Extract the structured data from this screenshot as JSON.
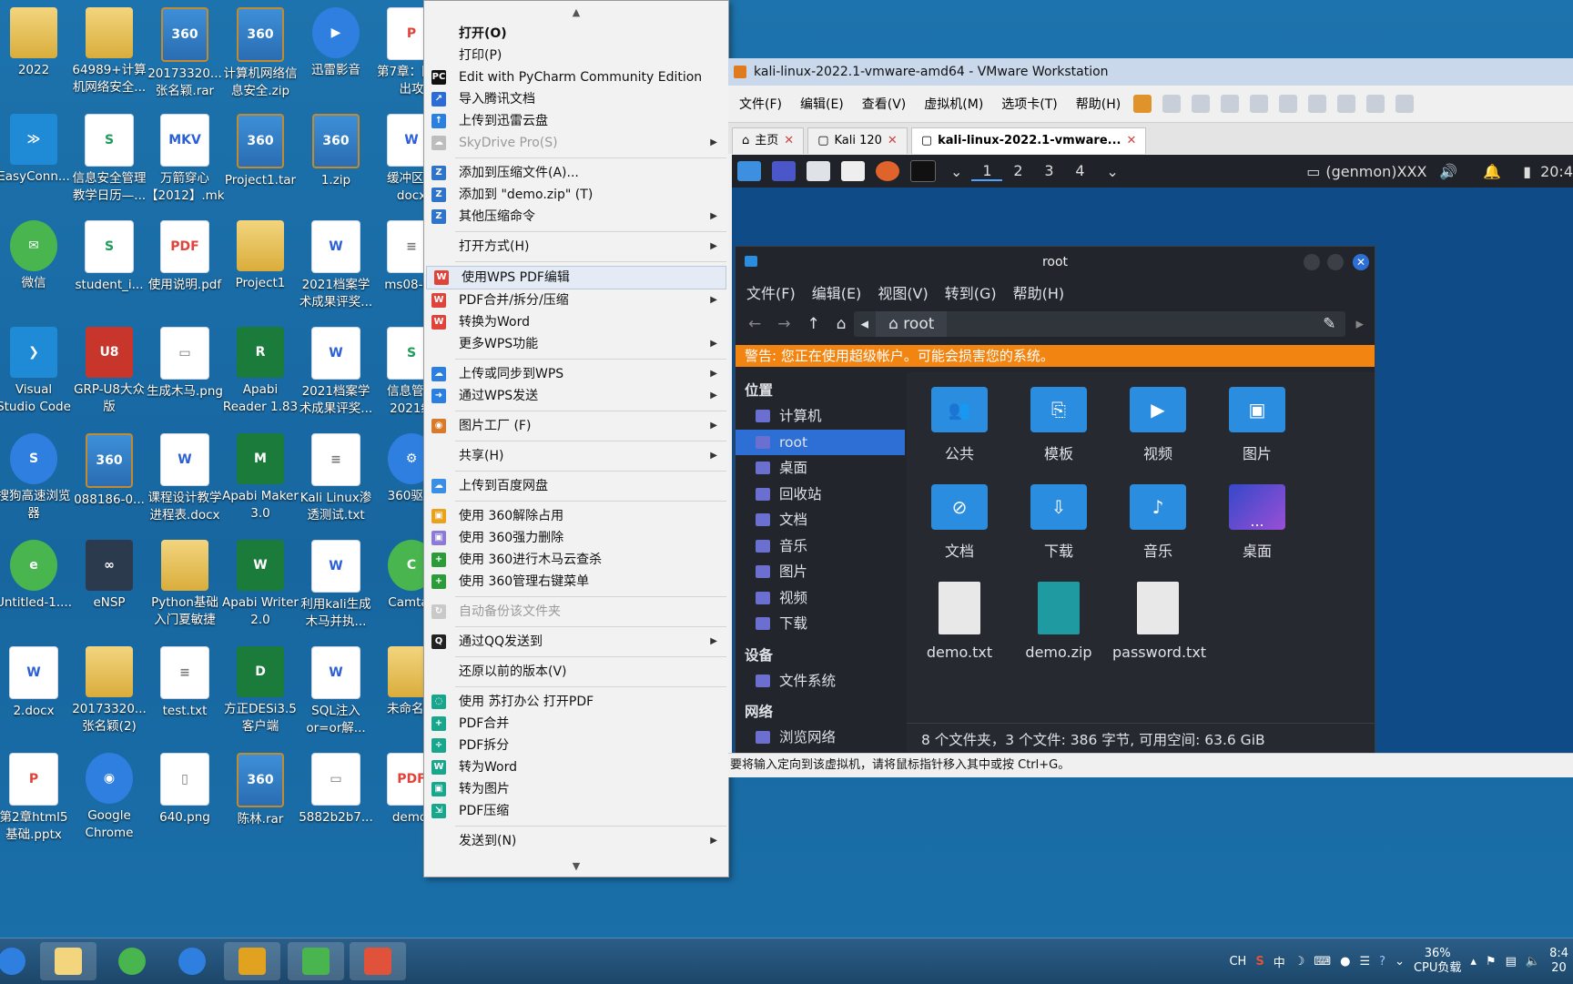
{
  "desktop": {
    "icons": [
      {
        "label": "2022",
        "kind": "folder",
        "glyph": ""
      },
      {
        "label": "64989+计算机网络安全...",
        "kind": "folder",
        "glyph": ""
      },
      {
        "label": "20173320...张名颖.rar",
        "kind": "zip",
        "glyph": "360"
      },
      {
        "label": "计算机网络信息安全.zip",
        "kind": "zip",
        "glyph": "360"
      },
      {
        "label": "迅雷影音",
        "kind": "blue",
        "glyph": "▶"
      },
      {
        "label": "第7章：区溢出攻",
        "kind": "pdf",
        "glyph": "P"
      },
      {
        "label": "EasyConn...",
        "kind": "vs",
        "glyph": "≫"
      },
      {
        "label": "信息安全管理教学日历—...",
        "kind": "xls",
        "glyph": "S"
      },
      {
        "label": "万箭穿心【2012】.mkv",
        "kind": "doc",
        "glyph": "MKV"
      },
      {
        "label": "Project1.tar",
        "kind": "zip",
        "glyph": "360"
      },
      {
        "label": "1.zip",
        "kind": "zip",
        "glyph": "360"
      },
      {
        "label": "缓冲区溢docx",
        "kind": "doc",
        "glyph": "W"
      },
      {
        "label": "微信",
        "kind": "green",
        "glyph": "✉"
      },
      {
        "label": "student_i...",
        "kind": "xls",
        "glyph": "S"
      },
      {
        "label": "使用说明.pdf",
        "kind": "pdf",
        "glyph": "PDF"
      },
      {
        "label": "Project1",
        "kind": "folder",
        "glyph": ""
      },
      {
        "label": "2021档案学术成果评奖...",
        "kind": "doc",
        "glyph": "W"
      },
      {
        "label": "ms08-06",
        "kind": "txt",
        "glyph": "≡"
      },
      {
        "label": "Visual Studio Code",
        "kind": "vs",
        "glyph": "❯"
      },
      {
        "label": "GRP-U8大众版",
        "kind": "red",
        "glyph": "U8"
      },
      {
        "label": "生成木马.png",
        "kind": "txt",
        "glyph": "▭"
      },
      {
        "label": "Apabi Reader 1.83",
        "kind": "app",
        "glyph": "R"
      },
      {
        "label": "2021档案学术成果评奖...",
        "kind": "doc",
        "glyph": "W"
      },
      {
        "label": "信息管理2021级",
        "kind": "xls",
        "glyph": "S"
      },
      {
        "label": "搜狗高速浏览器",
        "kind": "blue",
        "glyph": "S"
      },
      {
        "label": "088186-0...",
        "kind": "zip",
        "glyph": "360"
      },
      {
        "label": "课程设计教学进程表.docx",
        "kind": "doc",
        "glyph": "W"
      },
      {
        "label": "Apabi Maker 3.0",
        "kind": "app",
        "glyph": "M"
      },
      {
        "label": "Kali Linux渗透测试.txt",
        "kind": "txt",
        "glyph": "≡"
      },
      {
        "label": "360驱动",
        "kind": "blue",
        "glyph": "⚙"
      },
      {
        "label": "Untitled-1....",
        "kind": "green",
        "glyph": "e"
      },
      {
        "label": "eNSP",
        "kind": "dark",
        "glyph": "∞"
      },
      {
        "label": "Python基础入门夏敏捷",
        "kind": "folder",
        "glyph": ""
      },
      {
        "label": "Apabi Writer 2.0",
        "kind": "app",
        "glyph": "W"
      },
      {
        "label": "利用kali生成木马并执...",
        "kind": "doc",
        "glyph": "W"
      },
      {
        "label": "Camtas",
        "kind": "green",
        "glyph": "C"
      },
      {
        "label": "2.docx",
        "kind": "doc",
        "glyph": "W"
      },
      {
        "label": "20173320...张名颖(2)",
        "kind": "folder",
        "glyph": ""
      },
      {
        "label": "test.txt",
        "kind": "txt",
        "glyph": "≡"
      },
      {
        "label": "方正DESi3.5客户端",
        "kind": "app",
        "glyph": "D"
      },
      {
        "label": "SQL注入or=or解...",
        "kind": "doc",
        "glyph": "W"
      },
      {
        "label": "未命名项",
        "kind": "folder",
        "glyph": ""
      },
      {
        "label": "第2章html5基础.pptx",
        "kind": "pdf",
        "glyph": "P"
      },
      {
        "label": "Google Chrome",
        "kind": "blue",
        "glyph": "◉"
      },
      {
        "label": "640.png",
        "kind": "txt",
        "glyph": "▯"
      },
      {
        "label": "陈林.rar",
        "kind": "zip",
        "glyph": "360"
      },
      {
        "label": "5882b2b7...",
        "kind": "txt",
        "glyph": "▭"
      },
      {
        "label": "demo.",
        "kind": "pdf",
        "glyph": "PDF"
      }
    ]
  },
  "context_menu": {
    "items": [
      {
        "label": "打开(O)",
        "bold": true,
        "icon": "",
        "color": "",
        "arrow": false,
        "disabled": false
      },
      {
        "label": "打印(P)",
        "icon": "",
        "color": "",
        "arrow": false
      },
      {
        "label": "Edit with PyCharm Community Edition",
        "icon": "PC",
        "color": "#111111",
        "arrow": false
      },
      {
        "label": "导入腾讯文档",
        "icon": "↗",
        "color": "#2b6cd6",
        "arrow": false
      },
      {
        "label": "上传到迅雷云盘",
        "icon": "↑",
        "color": "#2b7fe0",
        "arrow": false
      },
      {
        "label": "SkyDrive Pro(S)",
        "icon": "☁",
        "color": "#bdbdbd",
        "arrow": true,
        "disabled": true
      },
      {
        "sep": true
      },
      {
        "label": "添加到压缩文件(A)...",
        "icon": "Z",
        "color": "#2f74c9",
        "arrow": false
      },
      {
        "label": "添加到 \"demo.zip\" (T)",
        "icon": "Z",
        "color": "#2f74c9",
        "arrow": false
      },
      {
        "label": "其他压缩命令",
        "icon": "Z",
        "color": "#2f74c9",
        "arrow": true
      },
      {
        "sep": true
      },
      {
        "label": "打开方式(H)",
        "icon": "",
        "color": "",
        "arrow": true
      },
      {
        "sep": true
      },
      {
        "label": "使用WPS PDF编辑",
        "icon": "W",
        "color": "#e0433a",
        "arrow": false,
        "highlight": true
      },
      {
        "label": "PDF合并/拆分/压缩",
        "icon": "W",
        "color": "#e0433a",
        "arrow": true
      },
      {
        "label": "转换为Word",
        "icon": "W",
        "color": "#e0433a",
        "arrow": false
      },
      {
        "label": "更多WPS功能",
        "icon": "",
        "color": "",
        "arrow": true
      },
      {
        "sep": true
      },
      {
        "label": "上传或同步到WPS",
        "icon": "☁",
        "color": "#2b7fe0",
        "arrow": true
      },
      {
        "label": "通过WPS发送",
        "icon": "➜",
        "color": "#2b7fe0",
        "arrow": true
      },
      {
        "sep": true
      },
      {
        "label": "图片工厂 (F)",
        "icon": "◉",
        "color": "#d77a2b",
        "arrow": true
      },
      {
        "sep": true
      },
      {
        "label": "共享(H)",
        "icon": "",
        "color": "",
        "arrow": true
      },
      {
        "sep": true
      },
      {
        "label": "上传到百度网盘",
        "icon": "☁",
        "color": "#3a8ee6",
        "arrow": false
      },
      {
        "sep": true
      },
      {
        "label": "使用 360解除占用",
        "icon": "▣",
        "color": "#e9a21c",
        "arrow": false
      },
      {
        "label": "使用 360强力删除",
        "icon": "▣",
        "color": "#8d7ad6",
        "arrow": false
      },
      {
        "label": "使用 360进行木马云查杀",
        "icon": "+",
        "color": "#2c9c3a",
        "arrow": false
      },
      {
        "label": "使用 360管理右键菜单",
        "icon": "+",
        "color": "#2c9c3a",
        "arrow": false
      },
      {
        "sep": true
      },
      {
        "label": "自动备份该文件夹",
        "icon": "↻",
        "color": "#c9c9c9",
        "arrow": false,
        "disabled": true
      },
      {
        "sep": true
      },
      {
        "label": "通过QQ发送到",
        "icon": "Q",
        "color": "#222222",
        "arrow": true
      },
      {
        "sep": true
      },
      {
        "label": "还原以前的版本(V)",
        "icon": "",
        "color": "",
        "arrow": false
      },
      {
        "sep": true
      },
      {
        "label": "使用 苏打办公 打开PDF",
        "icon": "◌",
        "color": "#18a78c",
        "arrow": false
      },
      {
        "label": "PDF合并",
        "icon": "+",
        "color": "#18a78c",
        "arrow": false
      },
      {
        "label": "PDF拆分",
        "icon": "÷",
        "color": "#18a78c",
        "arrow": false
      },
      {
        "label": "转为Word",
        "icon": "W",
        "color": "#18a78c",
        "arrow": false
      },
      {
        "label": "转为图片",
        "icon": "▣",
        "color": "#18a78c",
        "arrow": false
      },
      {
        "label": "PDF压缩",
        "icon": "⇲",
        "color": "#18a78c",
        "arrow": false
      },
      {
        "sep": true
      },
      {
        "label": "发送到(N)",
        "icon": "",
        "color": "",
        "arrow": true
      }
    ]
  },
  "vmware": {
    "title": "kali-linux-2022.1-vmware-amd64 - VMware Workstation",
    "menus": [
      "文件(F)",
      "编辑(E)",
      "查看(V)",
      "虚拟机(M)",
      "选项卡(T)",
      "帮助(H)"
    ],
    "tabs": [
      {
        "label": "主页",
        "icon": "⌂",
        "active": false
      },
      {
        "label": "Kali 120",
        "icon": "▢",
        "active": false
      },
      {
        "label": "kali-linux-2022.1-vmware...",
        "icon": "▢",
        "active": true
      }
    ],
    "status": "要将输入定向到该虚拟机，请将鼠标指针移入其中或按 Ctrl+G。"
  },
  "kali": {
    "workspaces": [
      "1",
      "2",
      "3",
      "4"
    ],
    "genmon": "(genmon)XXX",
    "clock": "20:4",
    "fm": {
      "title": "root",
      "menus": [
        "文件(F)",
        "编辑(E)",
        "视图(V)",
        "转到(G)",
        "帮助(H)"
      ],
      "path": "root",
      "warning": "警告: 您正在使用超级帐户。可能会损害您的系统。",
      "sidebar": {
        "places_header": "位置",
        "places": [
          "计算机",
          "root",
          "桌面",
          "回收站",
          "文档",
          "音乐",
          "图片",
          "视频",
          "下载"
        ],
        "devices_header": "设备",
        "devices": [
          "文件系统"
        ],
        "network_header": "网络",
        "network": [
          "浏览网络"
        ]
      },
      "items": [
        {
          "label": "公共",
          "type": "folder",
          "glyph": "👥"
        },
        {
          "label": "模板",
          "type": "folder",
          "glyph": "⎘"
        },
        {
          "label": "视频",
          "type": "folder",
          "glyph": "▶"
        },
        {
          "label": "图片",
          "type": "folder",
          "glyph": "▣"
        },
        {
          "label": "文档",
          "type": "folder",
          "glyph": "⊘"
        },
        {
          "label": "下载",
          "type": "folder",
          "glyph": "⇩"
        },
        {
          "label": "音乐",
          "type": "folder",
          "glyph": "♪"
        },
        {
          "label": "桌面",
          "type": "desk",
          "glyph": "..."
        },
        {
          "label": "demo.txt",
          "type": "file",
          "glyph": ""
        },
        {
          "label": "demo.zip",
          "type": "zipf",
          "glyph": ""
        },
        {
          "label": "password.txt",
          "type": "file",
          "glyph": ""
        }
      ],
      "status": "8 个文件夹，3 个文件: 386 字节, 可用空间: 63.6 GiB"
    }
  },
  "taskbar": {
    "tray": {
      "ime": "CH",
      "lang": "中",
      "cpu_percent": "36%",
      "cpu_label": "CPU负载",
      "time": "8:4",
      "date": "20"
    }
  }
}
